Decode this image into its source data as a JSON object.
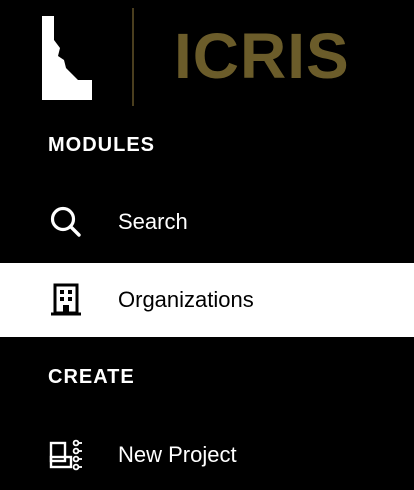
{
  "brand": {
    "name": "ICRIS",
    "logo_icon": "idaho-state-icon",
    "accent_color": "#6b5c2a"
  },
  "sections": {
    "modules_title": "MODULES",
    "create_title": "CREATE"
  },
  "nav": {
    "search": {
      "label": "Search",
      "icon": "search-icon"
    },
    "organizations": {
      "label": "Organizations",
      "icon": "building-icon",
      "active": true
    },
    "new_project": {
      "label": "New Project",
      "icon": "new-project-icon"
    }
  },
  "colors": {
    "background": "#000000",
    "active_background": "#ffffff",
    "text": "#ffffff",
    "active_text": "#000000"
  }
}
